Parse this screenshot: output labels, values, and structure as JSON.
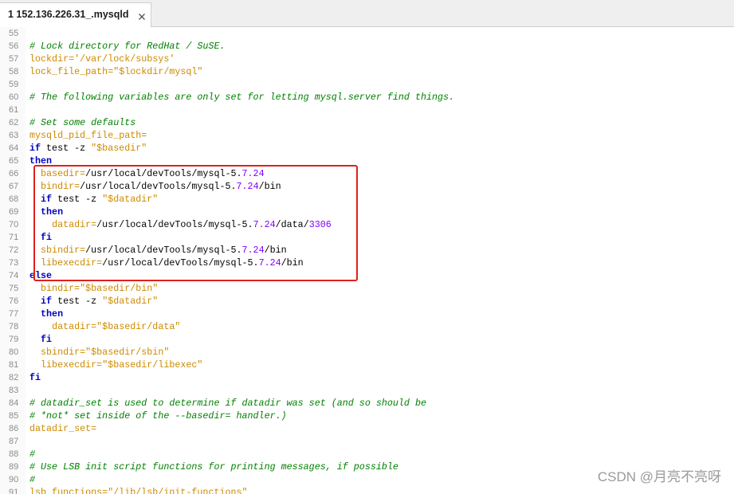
{
  "tab_bar": {
    "tabs": [
      {
        "label": "1 152.136.226.31_.mysqld",
        "close_icon": "close-icon"
      }
    ]
  },
  "editor": {
    "lines": [
      {
        "num": 55,
        "tokens": []
      },
      {
        "num": 56,
        "tokens": [
          {
            "comment": "# Lock directory for RedHat / SuSE."
          }
        ]
      },
      {
        "num": 57,
        "tokens": [
          {
            "variable": "lockdir="
          },
          {
            "string": "'/var/lock/subsys'"
          }
        ]
      },
      {
        "num": 58,
        "tokens": [
          {
            "variable": "lock_file_path="
          },
          {
            "string": "\"$lockdir/mysql\""
          }
        ]
      },
      {
        "num": 59,
        "tokens": []
      },
      {
        "num": 60,
        "tokens": [
          {
            "comment": "# The following variables are only set for letting mysql.server find things."
          }
        ]
      },
      {
        "num": 61,
        "tokens": []
      },
      {
        "num": 62,
        "tokens": [
          {
            "comment": "# Set some defaults"
          }
        ]
      },
      {
        "num": 63,
        "tokens": [
          {
            "variable": "mysqld_pid_file_path="
          }
        ]
      },
      {
        "num": 64,
        "tokens": [
          {
            "keyword": "if"
          },
          {
            "text": " test -z "
          },
          {
            "string": "\"$basedir\""
          }
        ]
      },
      {
        "num": 65,
        "tokens": [
          {
            "keyword": "then"
          }
        ]
      },
      {
        "num": 66,
        "tokens": [
          {
            "text": "  "
          },
          {
            "variable": "basedir="
          },
          {
            "text": "/usr/local/devTools/mysql-5."
          },
          {
            "number": "7.24"
          }
        ]
      },
      {
        "num": 67,
        "tokens": [
          {
            "text": "  "
          },
          {
            "variable": "bindir="
          },
          {
            "text": "/usr/local/devTools/mysql-5."
          },
          {
            "number": "7.24"
          },
          {
            "text": "/bin"
          }
        ]
      },
      {
        "num": 68,
        "tokens": [
          {
            "text": "  "
          },
          {
            "keyword": "if"
          },
          {
            "text": " test -z "
          },
          {
            "string": "\"$datadir\""
          }
        ]
      },
      {
        "num": 69,
        "tokens": [
          {
            "text": "  "
          },
          {
            "keyword": "then"
          }
        ]
      },
      {
        "num": 70,
        "tokens": [
          {
            "text": "    "
          },
          {
            "variable": "datadir="
          },
          {
            "text": "/usr/local/devTools/mysql-5."
          },
          {
            "number": "7.24"
          },
          {
            "text": "/data/"
          },
          {
            "number": "3306"
          }
        ]
      },
      {
        "num": 71,
        "tokens": [
          {
            "text": "  "
          },
          {
            "keyword": "fi"
          }
        ]
      },
      {
        "num": 72,
        "tokens": [
          {
            "text": "  "
          },
          {
            "variable": "sbindir="
          },
          {
            "text": "/usr/local/devTools/mysql-5."
          },
          {
            "number": "7.24"
          },
          {
            "text": "/bin"
          }
        ]
      },
      {
        "num": 73,
        "tokens": [
          {
            "text": "  "
          },
          {
            "variable": "libexecdir="
          },
          {
            "text": "/usr/local/devTools/mysql-5."
          },
          {
            "number": "7.24"
          },
          {
            "text": "/bin"
          }
        ]
      },
      {
        "num": 74,
        "tokens": [
          {
            "keyword": "else"
          }
        ]
      },
      {
        "num": 75,
        "tokens": [
          {
            "text": "  "
          },
          {
            "variable": "bindir="
          },
          {
            "string": "\"$basedir/bin\""
          }
        ]
      },
      {
        "num": 76,
        "tokens": [
          {
            "text": "  "
          },
          {
            "keyword": "if"
          },
          {
            "text": " test -z "
          },
          {
            "string": "\"$datadir\""
          }
        ]
      },
      {
        "num": 77,
        "tokens": [
          {
            "text": "  "
          },
          {
            "keyword": "then"
          }
        ]
      },
      {
        "num": 78,
        "tokens": [
          {
            "text": "    "
          },
          {
            "variable": "datadir="
          },
          {
            "string": "\"$basedir/data\""
          }
        ]
      },
      {
        "num": 79,
        "tokens": [
          {
            "text": "  "
          },
          {
            "keyword": "fi"
          }
        ]
      },
      {
        "num": 80,
        "tokens": [
          {
            "text": "  "
          },
          {
            "variable": "sbindir="
          },
          {
            "string": "\"$basedir/sbin\""
          }
        ]
      },
      {
        "num": 81,
        "tokens": [
          {
            "text": "  "
          },
          {
            "variable": "libexecdir="
          },
          {
            "string": "\"$basedir/libexec\""
          }
        ]
      },
      {
        "num": 82,
        "tokens": [
          {
            "keyword": "fi"
          }
        ]
      },
      {
        "num": 83,
        "tokens": []
      },
      {
        "num": 84,
        "tokens": [
          {
            "comment": "# datadir_set is used to determine if datadir was set (and so should be"
          }
        ]
      },
      {
        "num": 85,
        "tokens": [
          {
            "comment": "# *not* set inside of the --basedir= handler.)"
          }
        ]
      },
      {
        "num": 86,
        "tokens": [
          {
            "variable": "datadir_set="
          }
        ]
      },
      {
        "num": 87,
        "tokens": []
      },
      {
        "num": 88,
        "tokens": [
          {
            "comment": "#"
          }
        ]
      },
      {
        "num": 89,
        "tokens": [
          {
            "comment": "# Use LSB init script functions for printing messages, if possible"
          }
        ]
      },
      {
        "num": 90,
        "tokens": [
          {
            "comment": "#"
          }
        ]
      },
      {
        "num": 91,
        "tokens": [
          {
            "variable": "lsb_functions="
          },
          {
            "string": "\"/lib/lsb/init-functions\""
          }
        ]
      }
    ]
  },
  "watermark": "CSDN @月亮不亮呀",
  "theme": {
    "comment": "#008000",
    "keyword": "#0000c0",
    "variable": "#cc8a00",
    "string": "#cc8a00",
    "number": "#8000ff",
    "text": "#000000",
    "line_number": "#8c8c8c",
    "annotation": "#e0201c"
  }
}
